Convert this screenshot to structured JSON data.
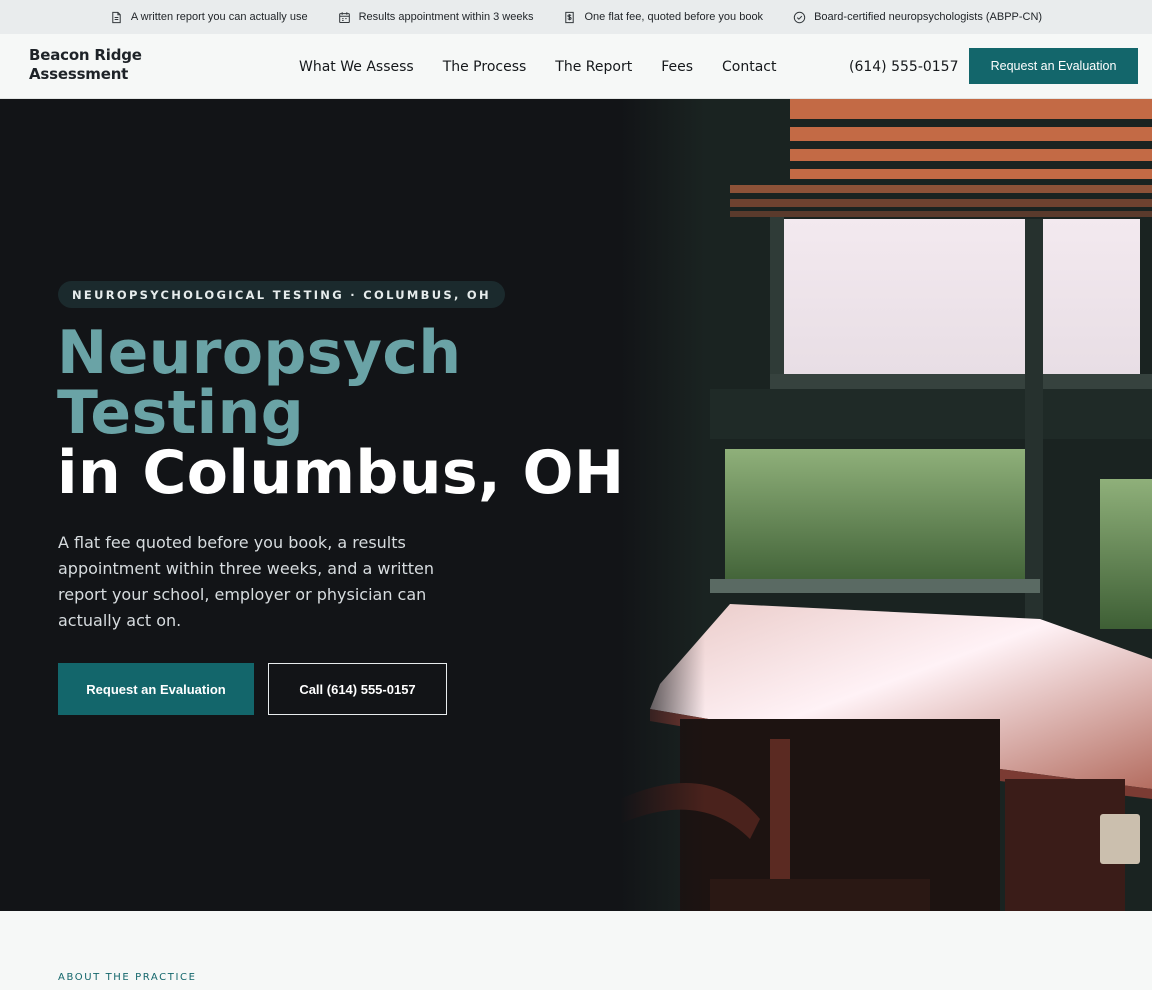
{
  "topbar": {
    "items": [
      {
        "icon": "document-icon",
        "text": "A written report you can actually use"
      },
      {
        "icon": "calendar-icon",
        "text": "Results appointment within 3 weeks"
      },
      {
        "icon": "dollar-icon",
        "text": "One flat fee, quoted before you book"
      },
      {
        "icon": "check-circle-icon",
        "text": "Board-certified neuropsychologists (ABPP-CN)"
      }
    ]
  },
  "header": {
    "logo_line1": "Beacon Ridge",
    "logo_line2": "Assessment",
    "nav": [
      "What We Assess",
      "The Process",
      "The Report",
      "Fees",
      "Contact"
    ],
    "phone": "(614) 555-0157",
    "cta": "Request an Evaluation"
  },
  "hero": {
    "badge": "NEUROPSYCHOLOGICAL TESTING · COLUMBUS, OH",
    "title_accent_1": "Neuropsych",
    "title_accent_2": "Testing",
    "title_white": "in Columbus, OH",
    "lead": "A flat fee quoted before you book, a results appointment within three weeks, and a written report your school, employer or physician can actually act on.",
    "primary_cta": "Request an Evaluation",
    "secondary_cta": "Call (614) 555-0157"
  },
  "about": {
    "eyebrow": "ABOUT THE PRACTICE"
  },
  "colors": {
    "accent": "#13666b",
    "title_accent": "#6aa3a6",
    "hero_bg": "#121417"
  }
}
